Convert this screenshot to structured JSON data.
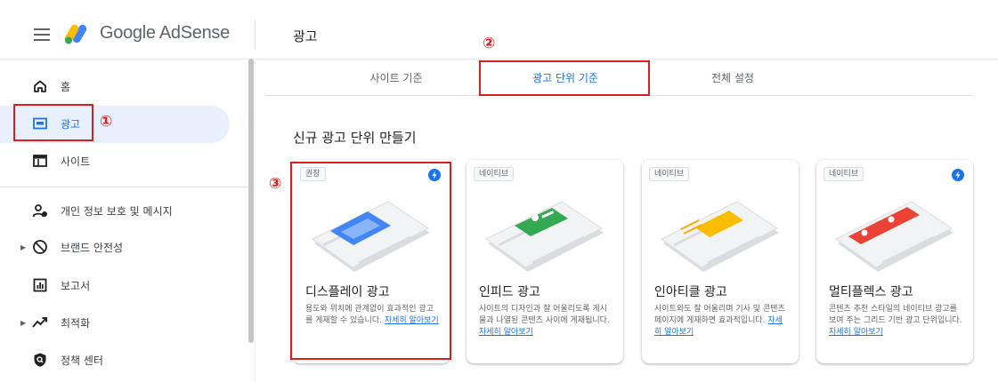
{
  "header": {
    "app_name": "Google AdSense",
    "page_title": "광고"
  },
  "sidebar": {
    "items": [
      {
        "label": "홈",
        "icon": "home-icon"
      },
      {
        "label": "광고",
        "icon": "ads-icon",
        "active": true
      },
      {
        "label": "사이트",
        "icon": "sites-icon"
      },
      {
        "label": "개인 정보 보호 및 메시지",
        "icon": "privacy-icon"
      },
      {
        "label": "브랜드 안전성",
        "icon": "block-icon"
      },
      {
        "label": "보고서",
        "icon": "reports-icon"
      },
      {
        "label": "최적화",
        "icon": "trending-icon"
      },
      {
        "label": "정책 센터",
        "icon": "policy-shield-icon"
      }
    ]
  },
  "tabs": [
    {
      "label": "사이트 기준"
    },
    {
      "label": "광고 단위 기준",
      "active": true
    },
    {
      "label": "전체 설정"
    }
  ],
  "section_title": "신규 광고 단위 만들기",
  "cards": [
    {
      "chip": "권장",
      "title": "디스플레이 광고",
      "desc": "용도와 위치에 관계없이 효과적인 광고를 게재할 수 있습니다.",
      "link": "자세히 알아보기",
      "bolt": true,
      "color": "#4285f4"
    },
    {
      "chip": "네이티브",
      "title": "인피드 광고",
      "desc": "사이트의 디자인과 잘 어울리도록 게시물과 나열된 콘텐츠 사이에 게재됩니다.",
      "link": "자세히 알아보기",
      "bolt": false,
      "color": "#34a853"
    },
    {
      "chip": "네이티브",
      "title": "인아티클 광고",
      "desc": "사이트와도 잘 어울리며 기사 및 콘텐츠 페이지에 게재하면 효과적입니다.",
      "link": "자세히 알아보기",
      "bolt": false,
      "color": "#fbbc04"
    },
    {
      "chip": "네이티브",
      "title": "멀티플렉스 광고",
      "desc": "콘텐츠 추천 스타일의 네이티브 광고를 보여 주는 그리드 기반 광고 단위입니다.",
      "link": "자세히 알아보기",
      "bolt": true,
      "color": "#ea4335"
    }
  ],
  "annotations": [
    "①",
    "②",
    "③"
  ],
  "colors": {
    "accent": "#1a73e8",
    "annotation": "#d62020",
    "active_bg": "#e8f0fe"
  }
}
